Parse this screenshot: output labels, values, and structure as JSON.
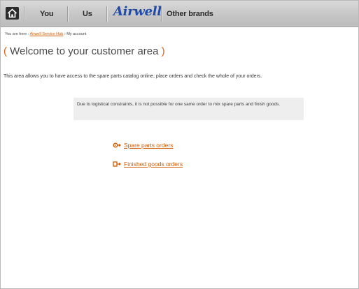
{
  "nav": {
    "you_label": "You",
    "us_label": "Us",
    "brand_label": "Airwell",
    "other_brands_label": "Other brands"
  },
  "breadcrumb": {
    "prefix": "You are here :",
    "home_link": "Airwell Service Hub",
    "separator": "›",
    "current": "My account"
  },
  "page": {
    "title_open": "(",
    "title": " Welcome to your customer area ",
    "title_close": ")",
    "intro": "This area allows you to have access to the spare parts catalog online, place orders and check the whole of your orders."
  },
  "notice": {
    "text": "Due to logistical constraints, it is not possible for one same order to mix spare parts and finish goods."
  },
  "links": {
    "spare_parts": "Spare parts orders",
    "finished_goods": "Finished goods orders"
  },
  "colors": {
    "accent": "#d45a00",
    "brand": "#1f4aa8"
  }
}
